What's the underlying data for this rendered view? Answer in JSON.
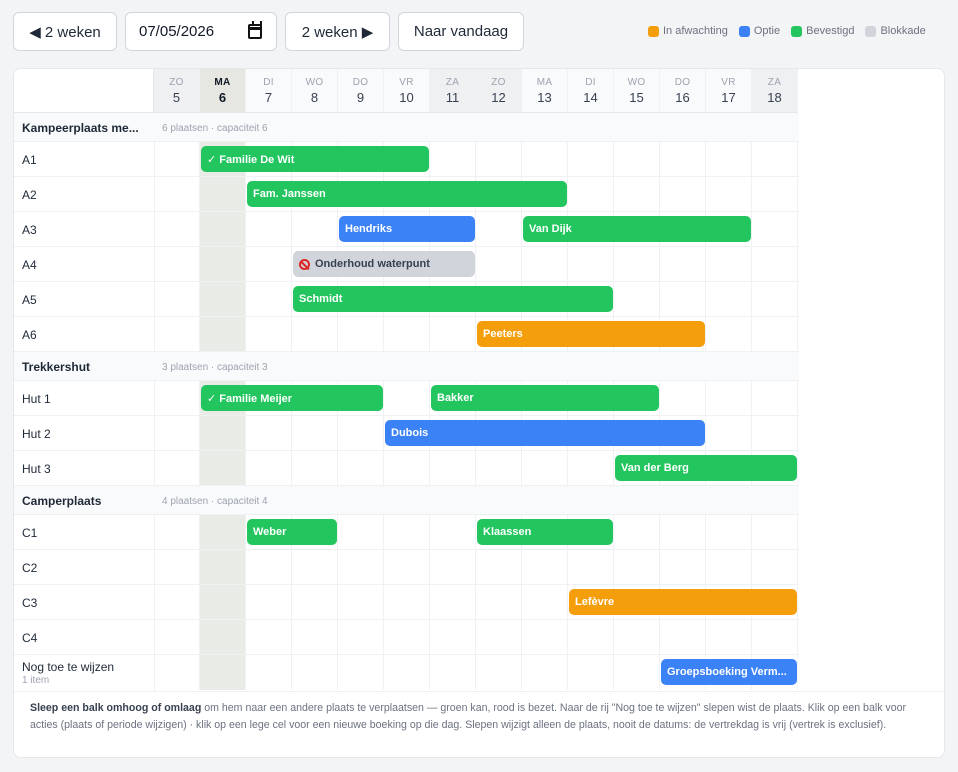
{
  "toolbar": {
    "prev_label": "◀ 2 weken",
    "date_value": "07/05/2026",
    "next_label": "2 weken ▶",
    "today_label": "Naar vandaag"
  },
  "legend": [
    {
      "label": "In afwachting",
      "color": "#f59e0b"
    },
    {
      "label": "Optie",
      "color": "#3b82f6"
    },
    {
      "label": "Bevestigd",
      "color": "#22c55e"
    },
    {
      "label": "Blokkade",
      "color": "#d1d5db"
    }
  ],
  "days": [
    {
      "dow": "ZO",
      "num": "5",
      "type": "weekend"
    },
    {
      "dow": "MA",
      "num": "6",
      "type": "today"
    },
    {
      "dow": "DI",
      "num": "7",
      "type": ""
    },
    {
      "dow": "WO",
      "num": "8",
      "type": ""
    },
    {
      "dow": "DO",
      "num": "9",
      "type": ""
    },
    {
      "dow": "VR",
      "num": "10",
      "type": ""
    },
    {
      "dow": "ZA",
      "num": "11",
      "type": "weekend"
    },
    {
      "dow": "ZO",
      "num": "12",
      "type": "weekend"
    },
    {
      "dow": "MA",
      "num": "13",
      "type": ""
    },
    {
      "dow": "DI",
      "num": "14",
      "type": ""
    },
    {
      "dow": "WO",
      "num": "15",
      "type": ""
    },
    {
      "dow": "DO",
      "num": "16",
      "type": ""
    },
    {
      "dow": "VR",
      "num": "17",
      "type": ""
    },
    {
      "dow": "ZA",
      "num": "18",
      "type": "weekend"
    }
  ],
  "groups": [
    {
      "title": "Kampeerplaats me...",
      "sub": "6 plaatsen · capaciteit 6",
      "rows": [
        {
          "label": "A1",
          "bars": [
            {
              "text": "✓ Familie De Wit",
              "status": "confirmed",
              "start": 1,
              "span": 5
            }
          ]
        },
        {
          "label": "A2",
          "bars": [
            {
              "text": "Fam. Janssen",
              "status": "confirmed",
              "start": 2,
              "span": 7
            }
          ]
        },
        {
          "label": "A3",
          "bars": [
            {
              "text": "Hendriks",
              "status": "option",
              "start": 4,
              "span": 3
            },
            {
              "text": "Van Dijk",
              "status": "confirmed",
              "start": 8,
              "span": 5
            }
          ]
        },
        {
          "label": "A4",
          "bars": [
            {
              "text": "Onderhoud waterpunt",
              "status": "block",
              "start": 3,
              "span": 4
            }
          ]
        },
        {
          "label": "A5",
          "bars": [
            {
              "text": "Schmidt",
              "status": "confirmed",
              "start": 3,
              "span": 7
            }
          ]
        },
        {
          "label": "A6",
          "bars": [
            {
              "text": "Peeters",
              "status": "pending",
              "start": 7,
              "span": 5
            }
          ]
        }
      ]
    },
    {
      "title": "Trekkershut",
      "sub": "3 plaatsen · capaciteit 3",
      "rows": [
        {
          "label": "Hut 1",
          "bars": [
            {
              "text": "✓ Familie Meijer",
              "status": "confirmed",
              "start": 1,
              "span": 4
            },
            {
              "text": "Bakker",
              "status": "confirmed",
              "start": 6,
              "span": 5
            }
          ]
        },
        {
          "label": "Hut 2",
          "bars": [
            {
              "text": "Dubois",
              "status": "option",
              "start": 5,
              "span": 7
            }
          ]
        },
        {
          "label": "Hut 3",
          "bars": [
            {
              "text": "Van der Berg",
              "status": "confirmed",
              "start": 10,
              "span": 4
            }
          ]
        }
      ]
    },
    {
      "title": "Camperplaats",
      "sub": "4 plaatsen · capaciteit 4",
      "rows": [
        {
          "label": "C1",
          "bars": [
            {
              "text": "Weber",
              "status": "confirmed",
              "start": 2,
              "span": 2
            },
            {
              "text": "Klaassen",
              "status": "confirmed",
              "start": 7,
              "span": 3
            }
          ]
        },
        {
          "label": "C2",
          "bars": []
        },
        {
          "label": "C3",
          "bars": [
            {
              "text": "Lefèvre",
              "status": "pending",
              "start": 9,
              "span": 5
            }
          ]
        },
        {
          "label": "C4",
          "bars": []
        }
      ]
    }
  ],
  "unassigned": {
    "label": "Nog toe te wijzen",
    "sub": "1 item",
    "bars": [
      {
        "text": "Groepsboeking Verm...",
        "status": "option",
        "start": 11,
        "span": 3
      }
    ]
  },
  "footnote": {
    "bold": "Sleep een balk omhoog of omlaag",
    "rest": " om hem naar een andere plaats te verplaatsen — groen kan, rood is bezet. Naar de rij \"Nog toe te wijzen\" slepen wist de plaats. Klik op een balk voor acties (plaats of periode wijzigen) · klik op een lege cel voor een nieuwe boeking op die dag. Slepen wijzigt alleen de plaats, nooit de datums: de vertrekdag is vrij (vertrek is exclusief)."
  }
}
